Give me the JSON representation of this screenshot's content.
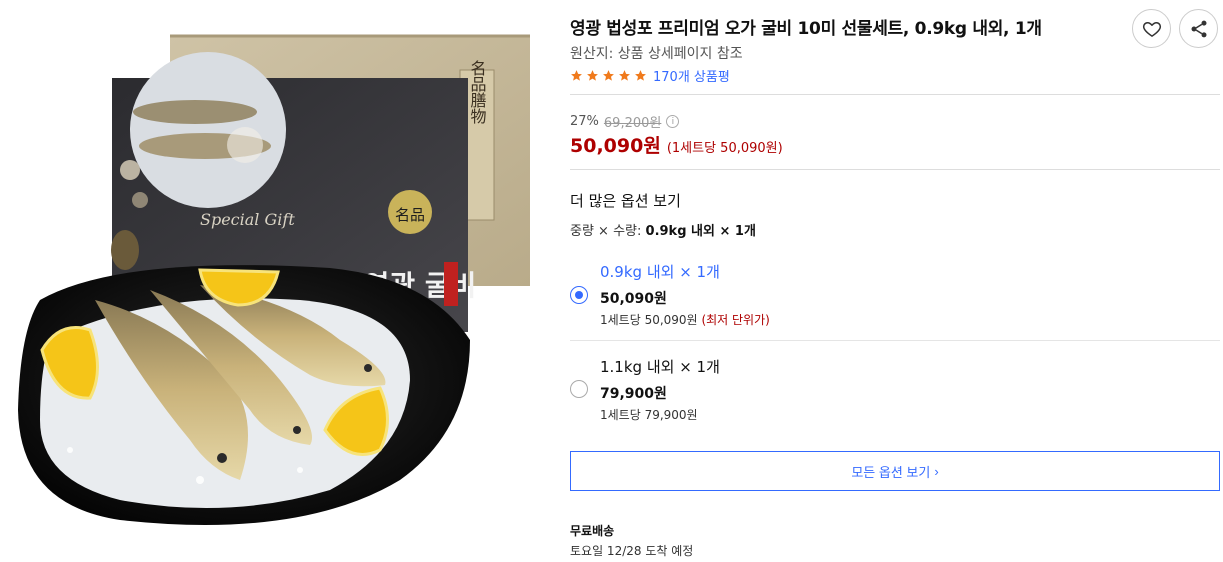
{
  "product": {
    "title": "영광 법성포 프리미엄 오가 굴비 10미 선물세트, 0.9kg 내외, 1개",
    "origin": "원산지: 상품 상세페이지 참조",
    "review_count": "170개 상품평",
    "rating": 5,
    "image_alt": "영광 굴비 선물세트"
  },
  "package_art": {
    "box_text_1": "名品",
    "box_text_2": "영광 굴비",
    "box_badge": "名品",
    "box_script": "Special Gift",
    "bag_text": "名品膳物"
  },
  "price": {
    "discount": "27%",
    "original": "69,200원",
    "info_icon": "i",
    "sale": "50,090원",
    "unit": "(1세트당 50,090원)"
  },
  "options": {
    "heading": "더 많은 옵션 보기",
    "selection_prefix": "중량 × 수량:",
    "selection_value": "0.9kg 내외 × 1개",
    "items": [
      {
        "label": "0.9kg 내외 × 1개",
        "price": "50,090원",
        "unit": "1세트당 50,090원",
        "badge": "(최저 단위가)",
        "selected": true
      },
      {
        "label": "1.1kg 내외 × 1개",
        "price": "79,900원",
        "unit": "1세트당 79,900원",
        "badge": "",
        "selected": false
      }
    ],
    "all_options_label": "모든 옵션 보기",
    "all_options_arrow": "›"
  },
  "shipping": {
    "label": "무료배송",
    "eta": "토요일 12/28 도착 예정"
  },
  "colors": {
    "accent_blue": "#346aff",
    "price_red": "#ae0000",
    "star_orange": "#f07a1c"
  },
  "icons": {
    "wishlist": "heart-icon",
    "share": "share-icon",
    "star": "star-icon",
    "info": "info-icon",
    "chevron": "chevron-right-icon"
  }
}
